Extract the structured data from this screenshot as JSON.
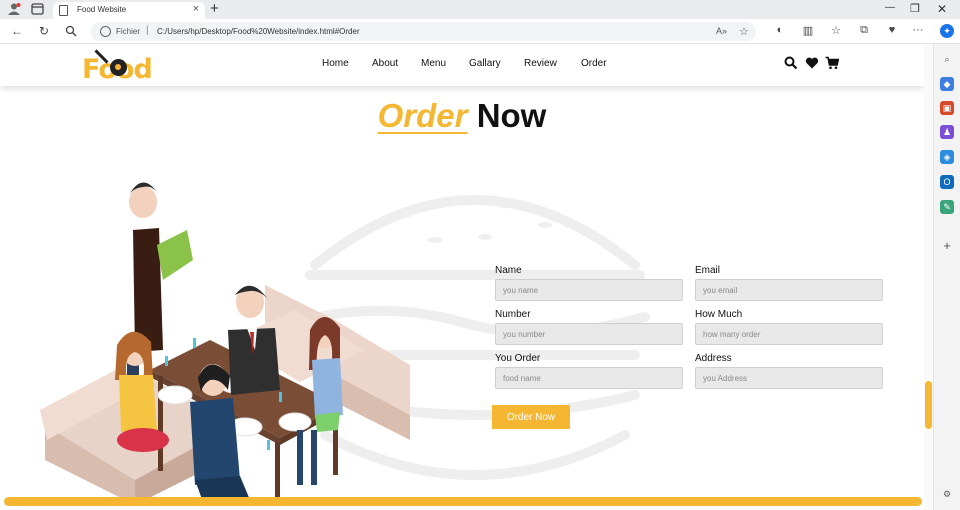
{
  "browser": {
    "tab_title": "Food Website",
    "fichier_label": "Fichier",
    "url": "C:/Users/hp/Desktop/Food%20Website/index.html#Order"
  },
  "site": {
    "logo_text": "Food",
    "nav": [
      {
        "label": "Home"
      },
      {
        "label": "About"
      },
      {
        "label": "Menu"
      },
      {
        "label": "Gallary"
      },
      {
        "label": "Review"
      },
      {
        "label": "Order"
      }
    ]
  },
  "section": {
    "heading_highlight": "Order",
    "heading_rest": "Now"
  },
  "form": {
    "name": {
      "label": "Name",
      "placeholder": "you name"
    },
    "email": {
      "label": "Email",
      "placeholder": "you email"
    },
    "number": {
      "label": "Number",
      "placeholder": "you number"
    },
    "how_much": {
      "label": "How Much",
      "placeholder": "how many order"
    },
    "you_order": {
      "label": "You Order",
      "placeholder": "food name"
    },
    "address": {
      "label": "Address",
      "placeholder": "you Address"
    },
    "submit_label": "Order Now"
  },
  "colors": {
    "accent": "#f5b731",
    "text": "#111111",
    "input_bg": "#e8e8e8"
  }
}
